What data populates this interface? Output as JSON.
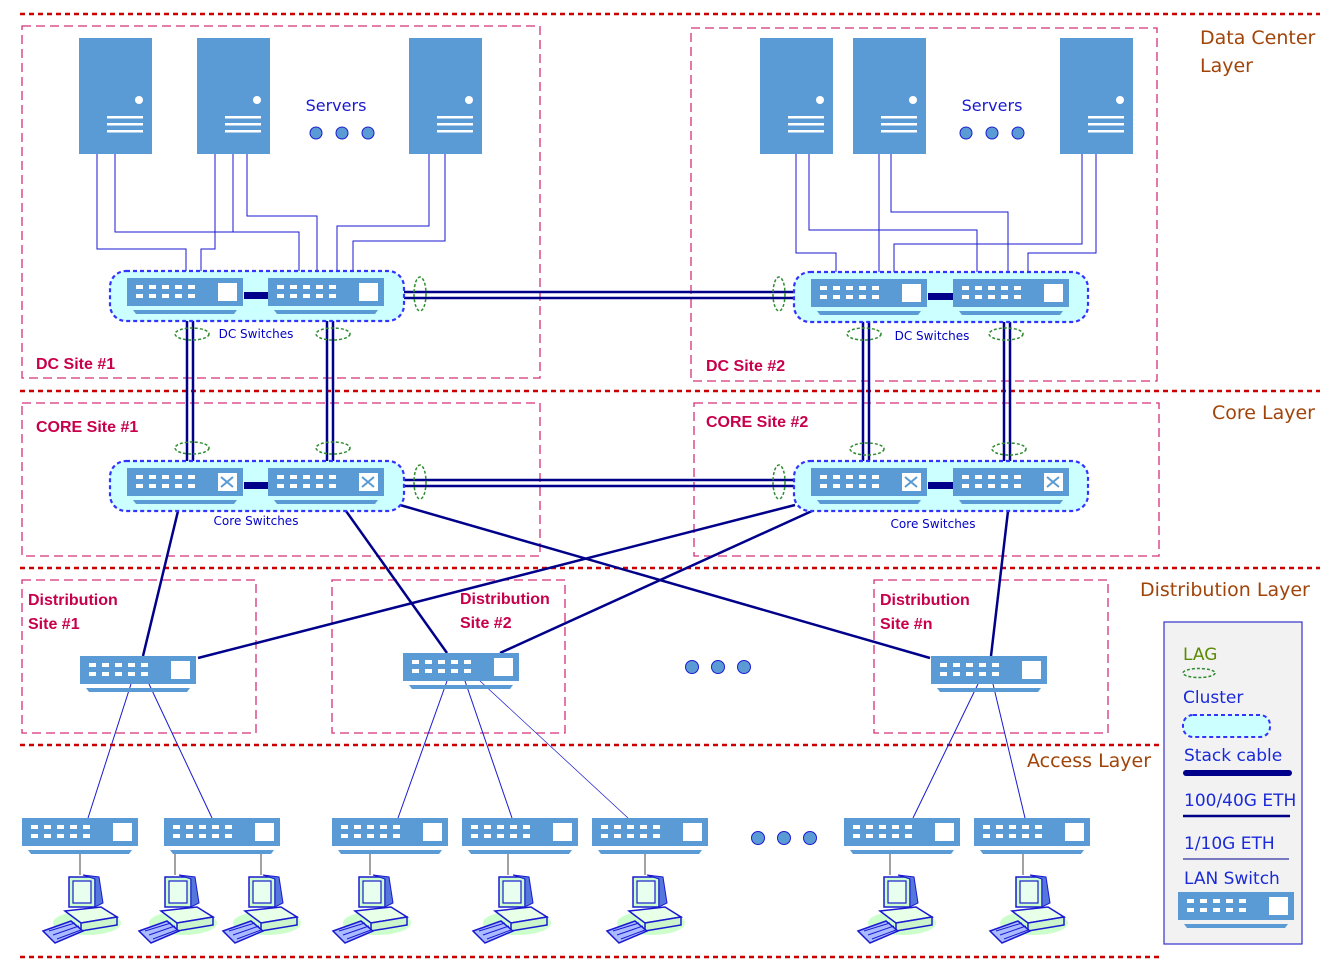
{
  "layers": {
    "data_center_line1": "Data Center",
    "data_center_line2": "Layer",
    "core": "Core Layer",
    "distribution": "Distribution Layer",
    "access": "Access Layer"
  },
  "sites": {
    "dc1": "DC Site #1",
    "dc2": "DC Site #2",
    "core1": "CORE Site #1",
    "core2": "CORE Site #2",
    "dist1_line1": "Distribution",
    "dist1_line2": "Site #1",
    "dist2_line1": "Distribution",
    "dist2_line2": "Site #2",
    "distn_line1": "Distribution",
    "distn_line2": "Site #n"
  },
  "labels": {
    "servers": "Servers",
    "dc_switches": "DC Switches",
    "core_switches": "Core Switches"
  },
  "legend": {
    "lag": "LAG",
    "cluster": "Cluster",
    "stack_cable": "Stack cable",
    "eth_100_40": "100/40G ETH",
    "eth_1_10": "1/10G ETH",
    "lan_switch": "LAN Switch"
  },
  "colors": {
    "device": "#5b9bd5",
    "cluster_fill": "#ccffff",
    "cluster_border": "#3333ff",
    "link": "#00008b",
    "lag": "#2e8b2e",
    "site_border": "#d6307a",
    "layer_divider": "#cc0000"
  }
}
